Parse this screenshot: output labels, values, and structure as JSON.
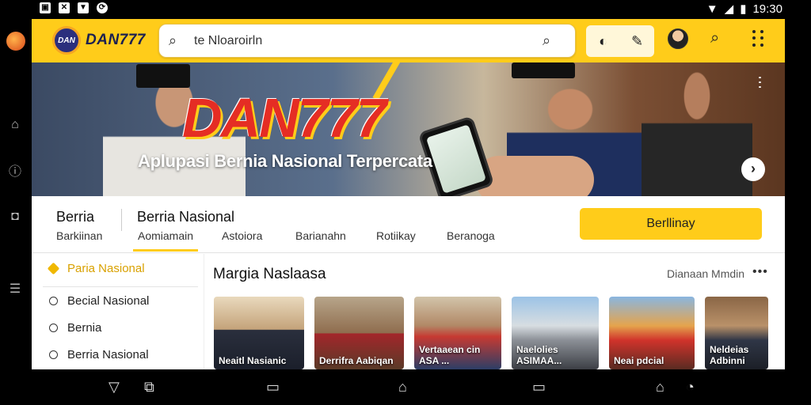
{
  "status_bar": {
    "time": "19:30",
    "left_icons": [
      "image-icon",
      "close-box-icon",
      "bookmark-icon",
      "sync-icon"
    ],
    "right_icons": [
      "wifi-icon",
      "signal-icon",
      "battery-icon"
    ]
  },
  "app": {
    "brand": {
      "badge": "DAN",
      "name": "DAN777"
    },
    "search": {
      "value": "te Nloaroirln"
    },
    "colors": {
      "accent": "#ffcc1a",
      "primary_text": "#111111",
      "active_item": "#d9a100",
      "logo_red": "#e52d24"
    }
  },
  "hero": {
    "title": "DAN777",
    "subtitle": "Aplupasi Bernia Nasional Terpercata"
  },
  "nav": {
    "section": "Berria",
    "section_sub": "Barkiinan",
    "title": "Berria Nasional",
    "tabs": [
      "Aomiamain",
      "Astoiora",
      "Barianahn",
      "Rotiikay",
      "Beranoga"
    ],
    "cta": "Berllinay"
  },
  "sidebar": {
    "items": [
      {
        "label": "Paria Nasional",
        "active": true
      },
      {
        "label": "Becial Nasional",
        "active": false
      },
      {
        "label": "Bernia",
        "active": false
      },
      {
        "label": "Berria Nasional",
        "active": false
      }
    ]
  },
  "content": {
    "title": "Margia Naslaasa",
    "right_label": "Dianaan Mmdin",
    "more": "•••",
    "cards": [
      {
        "caption": "Neaitl Nasianic"
      },
      {
        "caption": "Derrifra Aabiqan"
      },
      {
        "caption": "Vertaaean cin ASA ..."
      },
      {
        "caption": "Naelolies ASIMAA..."
      },
      {
        "caption": "Neai pdcial"
      },
      {
        "caption": "Neldeias Adbinni"
      }
    ]
  },
  "system_nav": {
    "icons": [
      "back-icon",
      "screenshot-icon",
      "recents-icon",
      "home-icon",
      "overview-icon",
      "assistant-icon"
    ]
  }
}
